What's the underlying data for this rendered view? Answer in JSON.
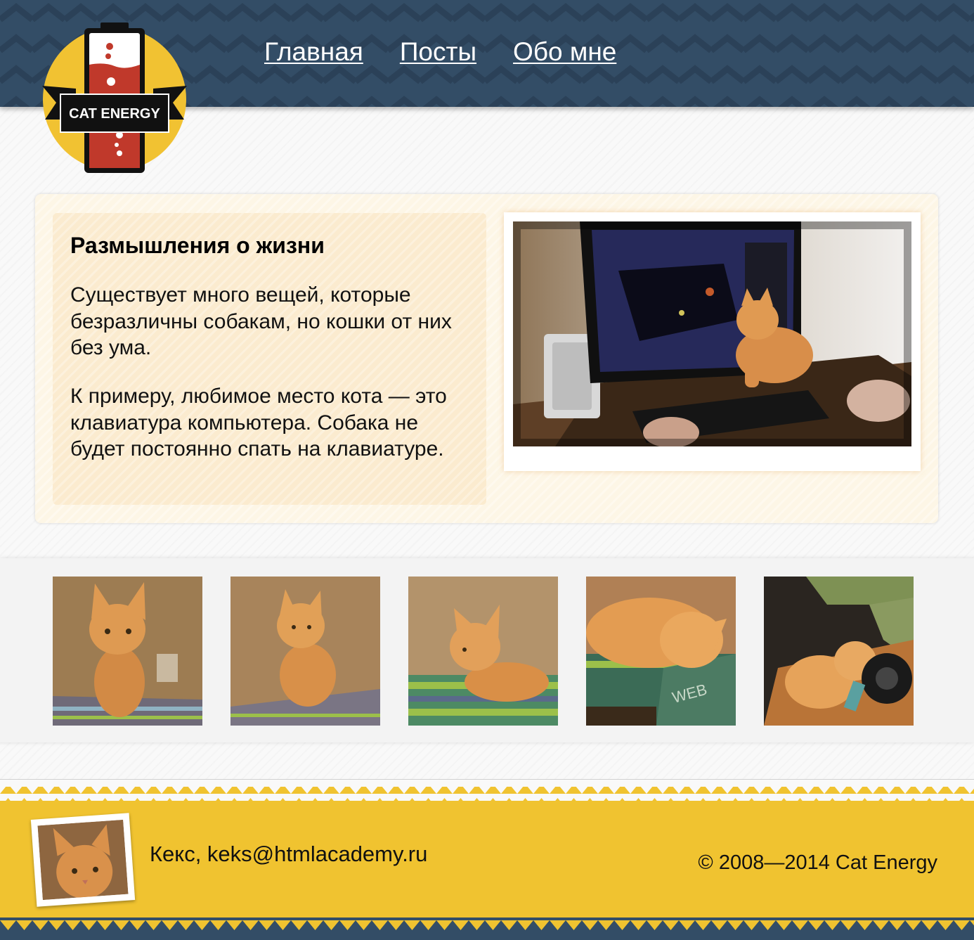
{
  "header": {
    "logo_text": "CAT ENERGY",
    "nav": [
      {
        "label": "Главная"
      },
      {
        "label": "Посты"
      },
      {
        "label": "Обо мне"
      }
    ]
  },
  "article": {
    "title": "Размышления о жизни",
    "paragraphs": [
      "Существует много вещей, которые безразличны собакам, но кошки от них без ума.",
      "К примеру, любимое место кота — это клавиатура компьютера. Собака не будет постоянно спать на клавиатуре."
    ]
  },
  "gallery": {
    "photos": [
      {
        "subject": "kitten-sitting"
      },
      {
        "subject": "kitten-sitting"
      },
      {
        "subject": "kitten-lying"
      },
      {
        "subject": "kitten-sleeping"
      },
      {
        "subject": "kitten-sleeping-headphones"
      }
    ]
  },
  "footer": {
    "contact": "Кекс, keks@htmlacademy.ru",
    "copyright": "© 2008—2014 Cat Energy"
  },
  "colors": {
    "header_bg": "#334d66",
    "logo_yellow": "#f1c232",
    "logo_red": "#c0392b",
    "footer_yellow": "#f0c330",
    "article_bg": "#fdf6e6",
    "text_box_bg": "#fbebcf"
  }
}
